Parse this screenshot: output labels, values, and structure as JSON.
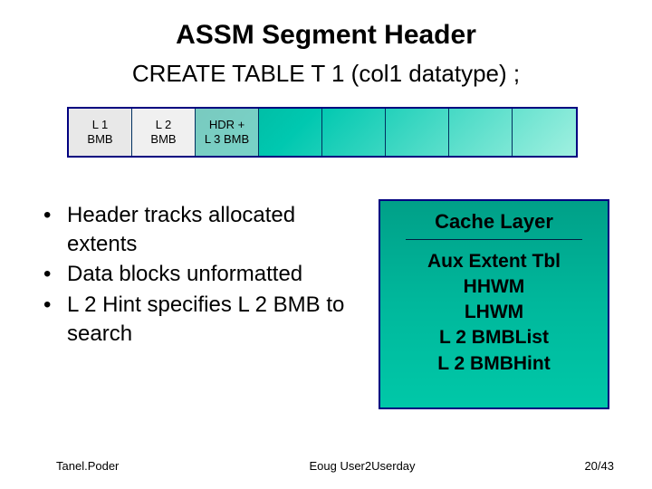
{
  "title": "ASSM Segment Header",
  "subtitle": "CREATE TABLE T 1 (col1 datatype) ;",
  "blocks": {
    "l1": "L 1\nBMB",
    "l2": "L 2\nBMB",
    "hdr": "HDR +\nL 3 BMB"
  },
  "bullets": [
    "Header tracks allocated extents",
    "Data blocks unformatted",
    "L 2 Hint specifies L 2 BMB to search"
  ],
  "cache": {
    "title": "Cache Layer",
    "items": [
      "Aux Extent Tbl",
      "HHWM",
      "LHWM",
      "L 2 BMBList",
      "L 2 BMBHint"
    ]
  },
  "footer": {
    "left": "Tanel.Poder",
    "center": "Eoug User2Userday",
    "right": "20/43"
  }
}
